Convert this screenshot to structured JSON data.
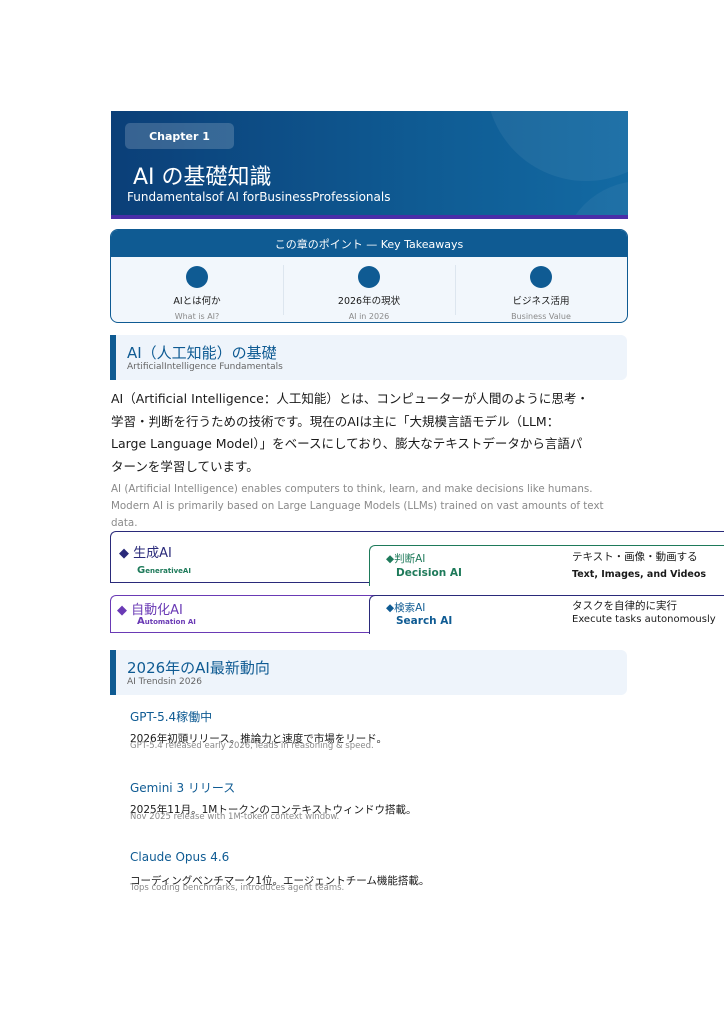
{
  "header": {
    "chapter": "Chapter 1",
    "title": "AI の基礎知識",
    "subtitle": "Fundamentalsof AI forBusinessProfessionals"
  },
  "takeaways": {
    "title": "この章のポイント — Key Takeaways",
    "items": [
      {
        "jp": "AIとは何か",
        "en": "What is AI?"
      },
      {
        "jp": "2026年の現状",
        "en": "AI in 2026"
      },
      {
        "jp": "ビジネス活用",
        "en": "Business Value"
      }
    ]
  },
  "section1": {
    "title": "AI（人工知能）の基礎",
    "subtitle": "ArtificialIntelligence Fundamentals",
    "body_jp": "AI（Artificial Intelligence：人工知能）とは、コンピューターが人間のように思考・学習・判断を行うための技術です。現在のAIは主に「大規模言語モデル（LLM：Large Language Model）」をベースにしており、膨大なテキストデータから言語パターンを学習しています。",
    "body_en": "AI (Artificial Intelligence) enables computers to think, learn, and make decisions like humans. Modern AI is primarily based on Large Language Models (LLMs) trained on vast amounts of text data."
  },
  "types": [
    {
      "title": "◆ 生成AI",
      "sub_initial": "G",
      "sub_rest": "enerativeAI",
      "inner_title": "◆判断AI",
      "inner_sub": "Decision AI",
      "desc_jp": "テキスト・画像・動画する",
      "desc_en": "Text, Images, and Videos"
    },
    {
      "title": "◆ 自動化AI",
      "sub_initial": "A",
      "sub_rest": "utomation AI",
      "inner_title": "◆検索AI",
      "inner_sub": "Search AI",
      "desc_jp": "タスクを自律的に実行",
      "desc_en": "Execute tasks autonomously"
    }
  ],
  "section2": {
    "title": "2026年のAI最新動向",
    "subtitle": "AI Trendsin 2026"
  },
  "trends": [
    {
      "title": "GPT-5.4稼働中",
      "jp": "2026年初頭リリース。推論力と速度で市場をリード。",
      "en": "GPT-5.4 released early 2026, leads in reasoning & speed."
    },
    {
      "title": "Gemini 3 リリース",
      "jp": "2025年11月。1Mトークンのコンテキストウィンドウ搭載。",
      "en": "Nov 2025 release with 1M-token context window."
    },
    {
      "title": "Claude Opus 4.6",
      "jp": "コーディングベンチマーク1位。エージェントチーム機能搭載。",
      "en": "Tops coding benchmarks, introduces agent teams."
    }
  ],
  "colors": {
    "primary": "#0f5b93",
    "dark_blue": "#0b3f78",
    "purple": "#6a3ab5",
    "green": "#1e7a5a",
    "navy": "#2a2a7a"
  }
}
